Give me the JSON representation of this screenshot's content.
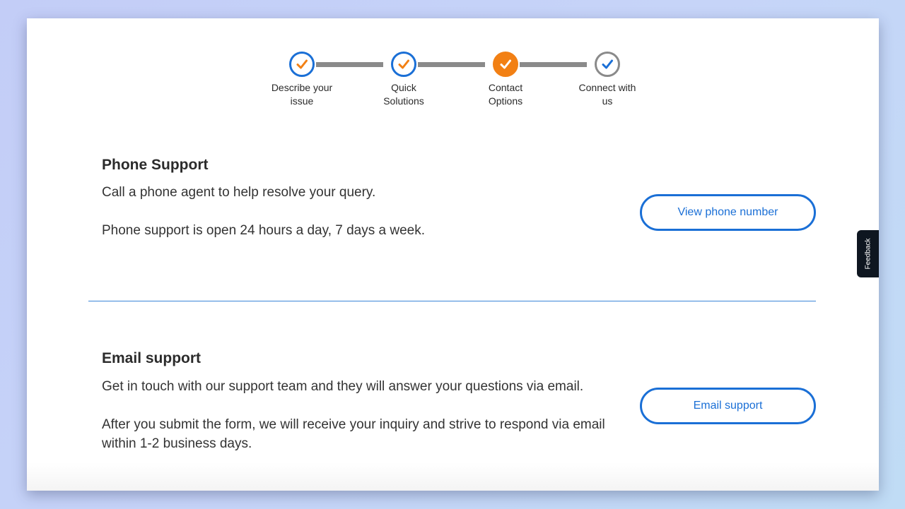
{
  "stepper": {
    "steps": [
      {
        "label": "Describe your issue",
        "state": "done"
      },
      {
        "label": "Quick Solutions",
        "state": "done"
      },
      {
        "label": "Contact Options",
        "state": "current"
      },
      {
        "label": "Connect with us",
        "state": "pending"
      }
    ],
    "step1_line1": "Describe your",
    "step1_line2": "issue",
    "step2_line1": "Quick",
    "step2_line2": "Solutions",
    "step3_line1": "Contact",
    "step3_line2": "Options",
    "step4_line1": "Connect with",
    "step4_line2": "us"
  },
  "phone": {
    "title": "Phone Support",
    "line1": "Call a phone agent to help resolve your query.",
    "line2": "Phone support is open 24 hours a day, 7 days a week.",
    "button_label": "View phone number"
  },
  "email": {
    "title": "Email support",
    "line1": "Get in touch with our support team and they will answer your questions via email.",
    "line2": "After you submit the form, we will receive your inquiry and strive to respond via email within 1-2 business days.",
    "button_label": "Email support"
  },
  "feedback": {
    "label": "Feedback"
  },
  "colors": {
    "accent_blue": "#1a6fd6",
    "accent_orange": "#f28014",
    "inactive_gray": "#8a8a8a"
  }
}
